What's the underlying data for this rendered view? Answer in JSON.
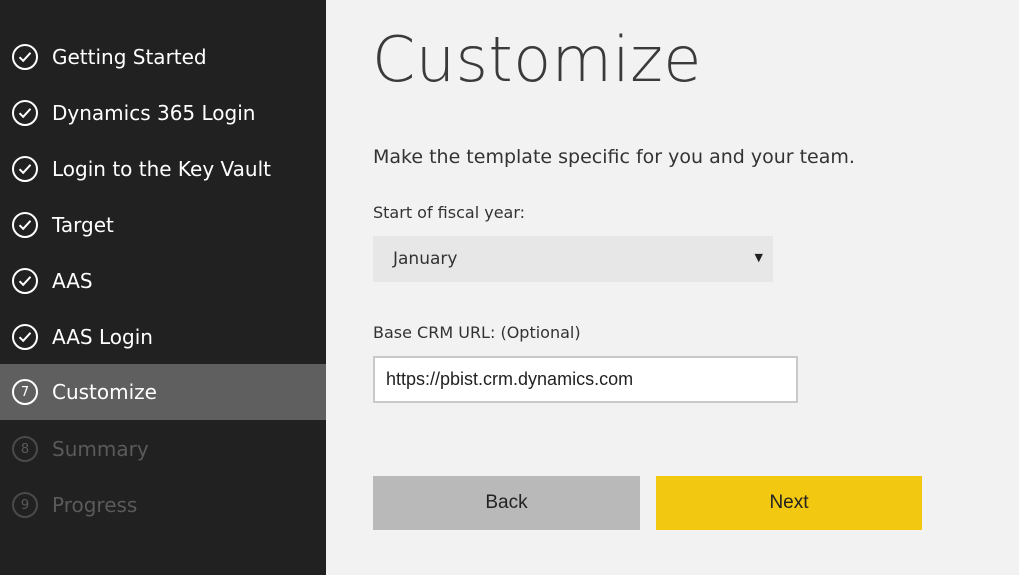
{
  "sidebar": {
    "items": [
      {
        "label": "Getting Started",
        "status": "complete",
        "icon": "check-circle-icon"
      },
      {
        "label": "Dynamics 365 Login",
        "status": "complete",
        "icon": "check-circle-icon"
      },
      {
        "label": "Login to the Key Vault",
        "status": "complete",
        "icon": "check-circle-icon"
      },
      {
        "label": "Target",
        "status": "complete",
        "icon": "check-circle-icon"
      },
      {
        "label": "AAS",
        "status": "complete",
        "icon": "check-circle-icon"
      },
      {
        "label": "AAS Login",
        "status": "complete",
        "icon": "check-circle-icon"
      },
      {
        "label": "Customize",
        "number": "7",
        "status": "active"
      },
      {
        "label": "Summary",
        "number": "8",
        "status": "pending"
      },
      {
        "label": "Progress",
        "number": "9",
        "status": "pending"
      }
    ]
  },
  "main": {
    "title": "Customize",
    "description": "Make the template specific for you and your team.",
    "fiscal_year": {
      "label": "Start of fiscal year:",
      "selected": "January",
      "caret": "▼"
    },
    "crm_url": {
      "label": "Base CRM URL: (Optional)",
      "value": "https://pbist.crm.dynamics.com"
    },
    "buttons": {
      "back": "Back",
      "next": "Next"
    }
  },
  "colors": {
    "sidebar_bg": "#212121",
    "active_item_bg": "#5f5f5f",
    "next_button": "#f2c811",
    "back_button": "#b9b9b9"
  }
}
